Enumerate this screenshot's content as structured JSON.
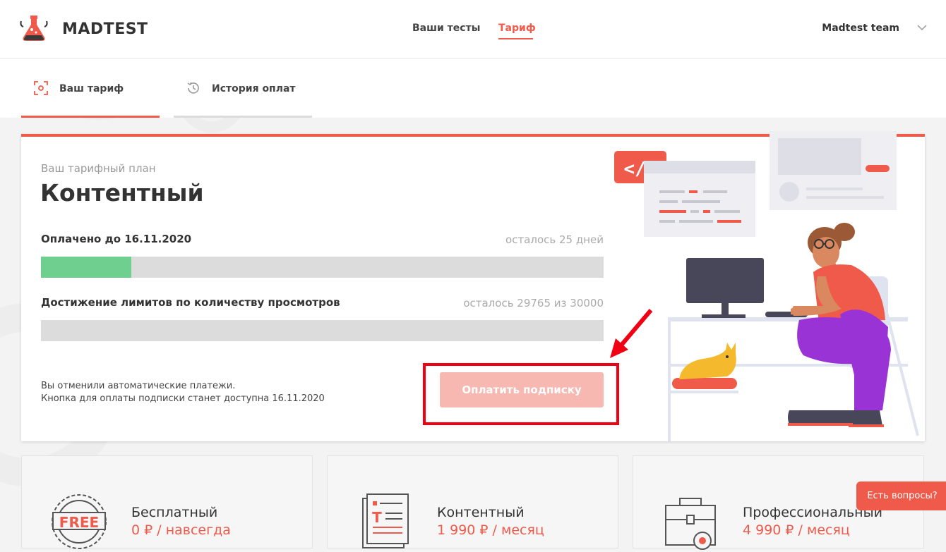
{
  "header": {
    "brand": "MADTEST",
    "nav": [
      {
        "label": "Ваши тесты",
        "active": false
      },
      {
        "label": "Тариф",
        "active": true
      }
    ],
    "user": "Madtest team"
  },
  "tabs": [
    {
      "label": "Ваш тариф",
      "icon": "target-icon",
      "active": true
    },
    {
      "label": "История оплат",
      "icon": "history-icon",
      "active": false
    }
  ],
  "plan": {
    "subtitle": "Ваш тарифный план",
    "name": "Контентный",
    "paid": {
      "label": "Оплачено до 16.11.2020",
      "remaining": "осталось 25 дней",
      "progress": 0.16
    },
    "limits": {
      "label": "Достижение лимитов по количеству просмотров",
      "remaining": "осталось 29765 из 30000",
      "progress": 0.0
    },
    "note_line1": "Вы отменили автоматические платежи.",
    "note_line2": "Кнопка для оплаты подписки станет доступна 16.11.2020",
    "pay_button": "Оплатить подписку",
    "illustration_code_label": "</>"
  },
  "pricing": [
    {
      "name": "Бесплатный",
      "price": "0 ₽ / навсегда",
      "icon": "free-badge-icon",
      "badge_text": "FREE"
    },
    {
      "name": "Контентный",
      "price": "1 990 ₽ / месяц",
      "icon": "document-icon"
    },
    {
      "name": "Профессиональный",
      "price": "4 990 ₽ / месяц",
      "icon": "briefcase-icon"
    }
  ],
  "help_button": "Есть вопросы?",
  "colors": {
    "accent": "#f05a4a",
    "progress": "#6fcf8f",
    "highlight": "#f00012"
  }
}
